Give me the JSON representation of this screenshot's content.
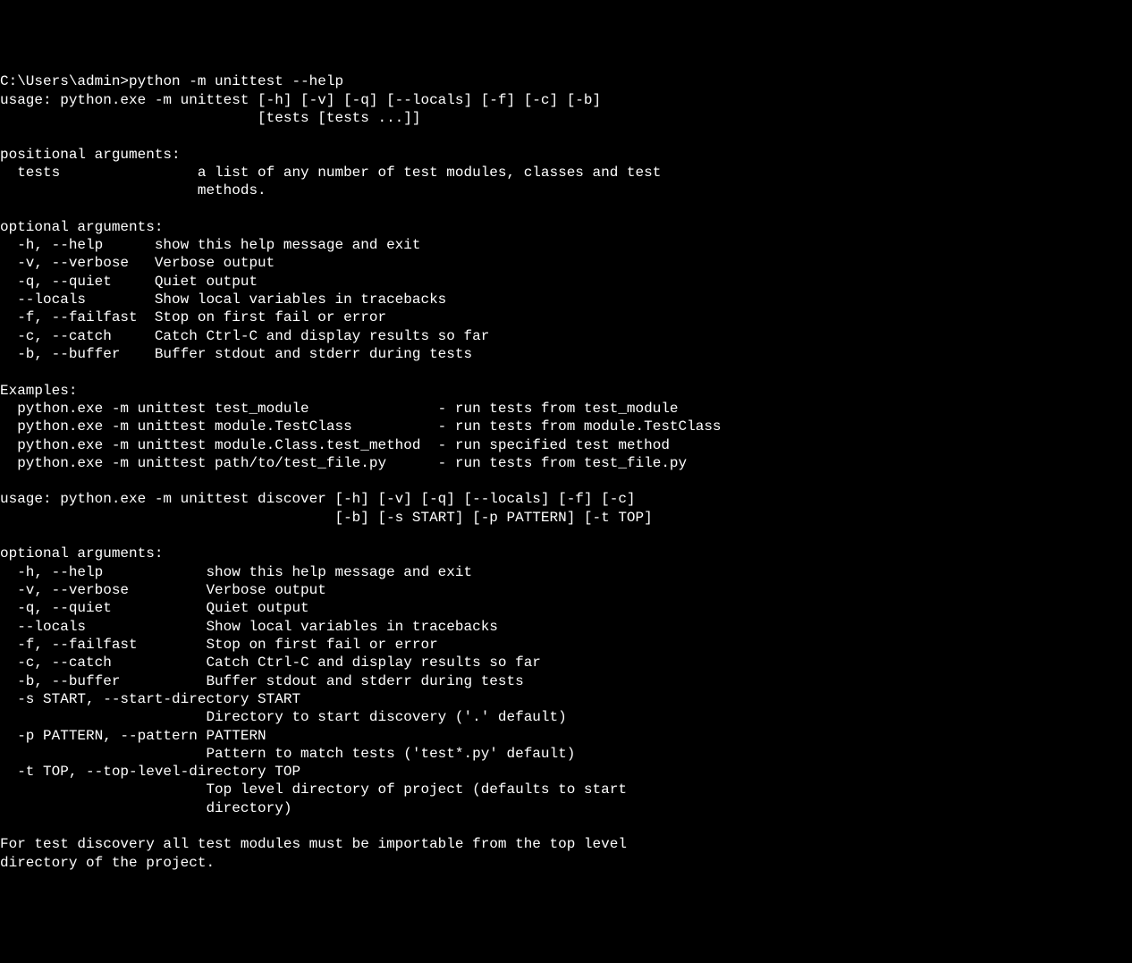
{
  "terminal": {
    "prompt": "C:\\Users\\admin>",
    "command": "python -m unittest --help",
    "usage1_line1": "usage: python.exe -m unittest [-h] [-v] [-q] [--locals] [-f] [-c] [-b]",
    "usage1_line2": "                              [tests [tests ...]]",
    "positional_header": "positional arguments:",
    "positional_tests": "  tests                a list of any number of test modules, classes and test",
    "positional_tests2": "                       methods.",
    "optional_header": "optional arguments:",
    "opt_help": "  -h, --help      show this help message and exit",
    "opt_verbose": "  -v, --verbose   Verbose output",
    "opt_quiet": "  -q, --quiet     Quiet output",
    "opt_locals": "  --locals        Show local variables in tracebacks",
    "opt_failfast": "  -f, --failfast  Stop on first fail or error",
    "opt_catch": "  -c, --catch     Catch Ctrl-C and display results so far",
    "opt_buffer": "  -b, --buffer    Buffer stdout and stderr during tests",
    "examples_header": "Examples:",
    "example1": "  python.exe -m unittest test_module               - run tests from test_module",
    "example2": "  python.exe -m unittest module.TestClass          - run tests from module.TestClass",
    "example3": "  python.exe -m unittest module.Class.test_method  - run specified test method",
    "example4": "  python.exe -m unittest path/to/test_file.py      - run tests from test_file.py",
    "usage2_line1": "usage: python.exe -m unittest discover [-h] [-v] [-q] [--locals] [-f] [-c]",
    "usage2_line2": "                                       [-b] [-s START] [-p PATTERN] [-t TOP]",
    "optional_header2": "optional arguments:",
    "opt2_help": "  -h, --help            show this help message and exit",
    "opt2_verbose": "  -v, --verbose         Verbose output",
    "opt2_quiet": "  -q, --quiet           Quiet output",
    "opt2_locals": "  --locals              Show local variables in tracebacks",
    "opt2_failfast": "  -f, --failfast        Stop on first fail or error",
    "opt2_catch": "  -c, --catch           Catch Ctrl-C and display results so far",
    "opt2_buffer": "  -b, --buffer          Buffer stdout and stderr during tests",
    "opt2_start1": "  -s START, --start-directory START",
    "opt2_start2": "                        Directory to start discovery ('.' default)",
    "opt2_pattern1": "  -p PATTERN, --pattern PATTERN",
    "opt2_pattern2": "                        Pattern to match tests ('test*.py' default)",
    "opt2_top1": "  -t TOP, --top-level-directory TOP",
    "opt2_top2": "                        Top level directory of project (defaults to start",
    "opt2_top3": "                        directory)",
    "footer1": "For test discovery all test modules must be importable from the top level",
    "footer2": "directory of the project."
  }
}
